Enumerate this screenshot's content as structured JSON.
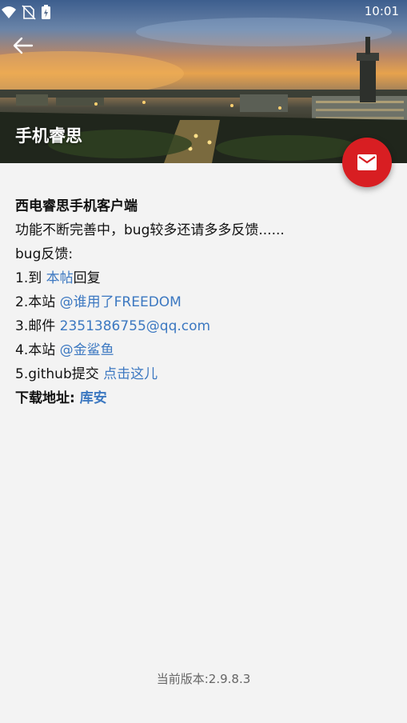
{
  "status_bar": {
    "time": "10:01",
    "icons": [
      "wifi-icon",
      "no-sim-icon",
      "battery-charging-icon"
    ]
  },
  "header": {
    "title": "手机睿思",
    "back_icon": "arrow-left-icon",
    "fab_icon": "mail-icon",
    "colors": {
      "fab": "#d81e22",
      "link": "#3c78c1"
    }
  },
  "content": {
    "app_name": "西电睿思手机客户端",
    "desc": "功能不断完善中，bug较多还请多多反馈......",
    "feedback_label": "bug反馈:",
    "items": [
      {
        "prefix": "1.到 ",
        "link": "本帖",
        "suffix": "回复"
      },
      {
        "prefix": "2.本站 ",
        "link": "@谁用了FREEDOM",
        "suffix": ""
      },
      {
        "prefix": "3.邮件 ",
        "link": "2351386755@qq.com",
        "suffix": ""
      },
      {
        "prefix": "4.本站 ",
        "link": "@金鲨鱼",
        "suffix": ""
      },
      {
        "prefix": "5.github提交 ",
        "link": "点击这儿",
        "suffix": ""
      }
    ],
    "download_label": "下载地址: ",
    "download_link": "库安"
  },
  "footer": {
    "version": "当前版本:2.9.8.3"
  }
}
